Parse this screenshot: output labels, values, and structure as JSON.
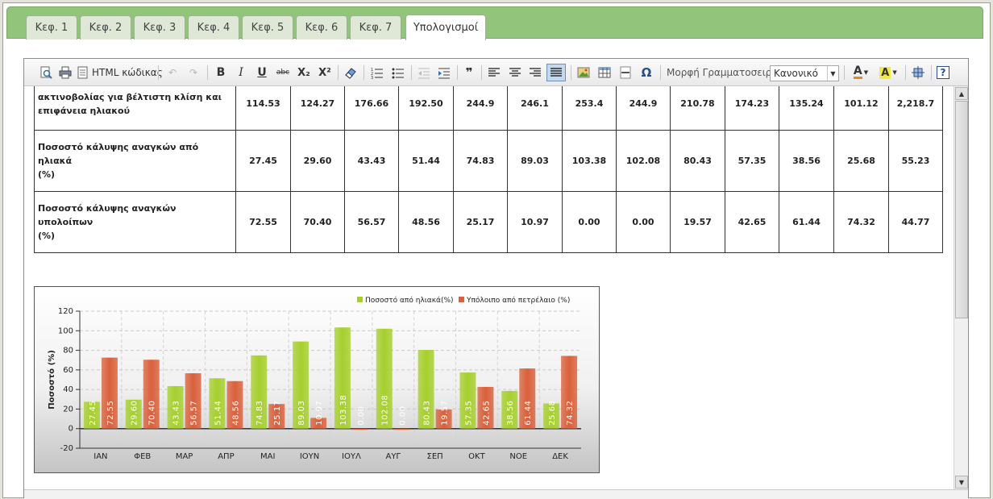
{
  "tabs": [
    {
      "label": "Κεφ. 1",
      "active": false
    },
    {
      "label": "Κεφ. 2",
      "active": false
    },
    {
      "label": "Κεφ. 3",
      "active": false
    },
    {
      "label": "Κεφ. 4",
      "active": false
    },
    {
      "label": "Κεφ. 5",
      "active": false
    },
    {
      "label": "Κεφ. 6",
      "active": false
    },
    {
      "label": "Κεφ. 7",
      "active": false
    },
    {
      "label": "Υπολογισμοί",
      "active": true
    }
  ],
  "toolbar": {
    "html_code_label": "HTML κώδικας",
    "bold": "B",
    "italic": "I",
    "underline": "U",
    "strike": "abc",
    "subscript": "X₂",
    "superscript": "X²",
    "blockquote": "❞",
    "omega": "Ω",
    "help": "?",
    "font_format_label": "Μορφή Γραμματοσειράς",
    "font_format_value": "Κανονικό",
    "font_color_letter": "A",
    "bg_color_letter": "A",
    "accent_color": "#6e8fb8"
  },
  "table": {
    "rows": [
      {
        "label_lines": [
          "ακτινοβολίας για βέλτιστη κλίση και",
          "επιφάνεια ηλιακού"
        ],
        "values": [
          "114.53",
          "124.27",
          "176.66",
          "192.50",
          "244.9",
          "246.1",
          "253.4",
          "244.9",
          "210.78",
          "174.23",
          "135.24",
          "101.12",
          "2,218.7"
        ]
      },
      {
        "label_lines": [
          "Ποσοστό κάλυψης αναγκών από ηλιακά",
          "(%)"
        ],
        "values": [
          "27.45",
          "29.60",
          "43.43",
          "51.44",
          "74.83",
          "89.03",
          "103.38",
          "102.08",
          "80.43",
          "57.35",
          "38.56",
          "25.68",
          "55.23"
        ]
      },
      {
        "label_lines": [
          "Ποσοστό κάλυψης αναγκών υπολοίπων",
          "(%)"
        ],
        "values": [
          "72.55",
          "70.40",
          "56.57",
          "48.56",
          "25.17",
          "10.97",
          "0.00",
          "0.00",
          "19.57",
          "42.65",
          "61.44",
          "74.32",
          "44.77"
        ]
      }
    ]
  },
  "chart_data": {
    "type": "bar",
    "categories": [
      "ΙΑΝ",
      "ΦΕΒ",
      "ΜΑΡ",
      "ΑΠΡ",
      "ΜΑΙ",
      "ΙΟΥΝ",
      "ΙΟΥΛ",
      "ΑΥΓ",
      "ΣΕΠ",
      "ΟΚΤ",
      "ΝΟΕ",
      "ΔΕΚ"
    ],
    "series": [
      {
        "name": "Ποσοστό από ηλιακά(%)",
        "color": "#a6cf2c",
        "values": [
          27.45,
          29.6,
          43.43,
          51.44,
          74.83,
          89.03,
          103.38,
          102.08,
          80.43,
          57.35,
          38.56,
          25.68
        ]
      },
      {
        "name": "Υπόλοιπο από πετρέλαιο (%)",
        "color": "#d9603a",
        "values": [
          72.55,
          70.4,
          56.57,
          48.56,
          25.17,
          10.97,
          0.0,
          0.0,
          19.57,
          42.65,
          61.44,
          74.32
        ]
      }
    ],
    "ylabel": "Ποσοστό (%)",
    "ylim": [
      -20,
      120
    ],
    "yticks": [
      -20,
      0,
      20,
      40,
      60,
      80,
      100,
      120
    ],
    "grid": true,
    "legend": "top-right"
  }
}
